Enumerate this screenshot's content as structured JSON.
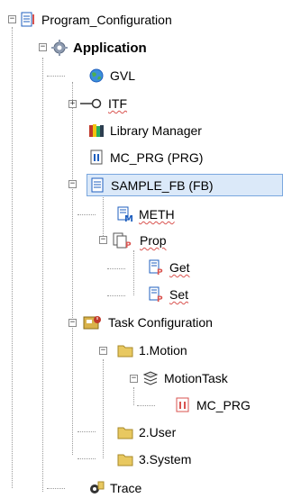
{
  "tree": {
    "root": "Program_Configuration",
    "application": "Application",
    "gvl": "GVL",
    "itf": "ITF",
    "library_manager": "Library Manager",
    "mc_prg": "MC_PRG (PRG)",
    "sample_fb": "SAMPLE_FB (FB)",
    "meth": "METH",
    "prop": "Prop",
    "get": "Get",
    "set": "Set",
    "task_configuration": "Task Configuration",
    "motion": "1.Motion",
    "motion_task": "MotionTask",
    "motion_task_call": "MC_PRG",
    "user": "2.User",
    "system": "3.System",
    "trace": "Trace"
  },
  "colors": {
    "selection_bg": "#dbe9f9",
    "selection_border": "#7aa7de",
    "folder": "#e8c860",
    "accent_red": "#d9534f",
    "accent_blue": "#1f5fbf"
  }
}
